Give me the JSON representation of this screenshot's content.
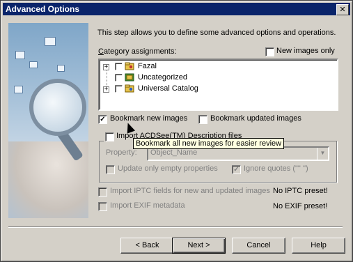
{
  "window": {
    "title": "Advanced Options",
    "close_glyph": "✕"
  },
  "intro": "This step allows you to define some advanced options and operations.",
  "category": {
    "label": "Category assignments:",
    "new_images_only": "New images only",
    "items": [
      {
        "label": "Fazal",
        "expander": "+"
      },
      {
        "label": "Uncategorized",
        "expander": ""
      },
      {
        "label": "Universal Catalog",
        "expander": "+"
      }
    ]
  },
  "bookmark_new": {
    "label": "Bookmark new images",
    "checked": "✓"
  },
  "bookmark_updated": {
    "label": "Bookmark updated images"
  },
  "import_desc": {
    "label": "Import ACDSee(TM) Description files"
  },
  "property": {
    "label": "Property:",
    "value": "Object_Name",
    "arrow": "▼"
  },
  "update_empty": {
    "label": "Update only empty properties"
  },
  "ignore_quotes": {
    "label": "Ignore quotes (\"\" '')",
    "checked": "✓"
  },
  "iptc": {
    "label": "Import IPTC fields for new and updated images",
    "status": "No IPTC preset!"
  },
  "exif": {
    "label": "Import EXIF metadata",
    "status": "No EXIF preset!"
  },
  "tooltip": "Bookmark all new images for easier review",
  "buttons": {
    "back": "< Back",
    "next": "Next >",
    "cancel": "Cancel",
    "help": "Help"
  },
  "icons": {
    "side": "magnifier-hand-image",
    "cursor": "pointer-cursor-icon",
    "tree": "category-folder-icon"
  },
  "colors": {
    "title_bar": "#0a246a",
    "face": "#d4d0c8",
    "tooltip_bg": "#ffffe1"
  }
}
